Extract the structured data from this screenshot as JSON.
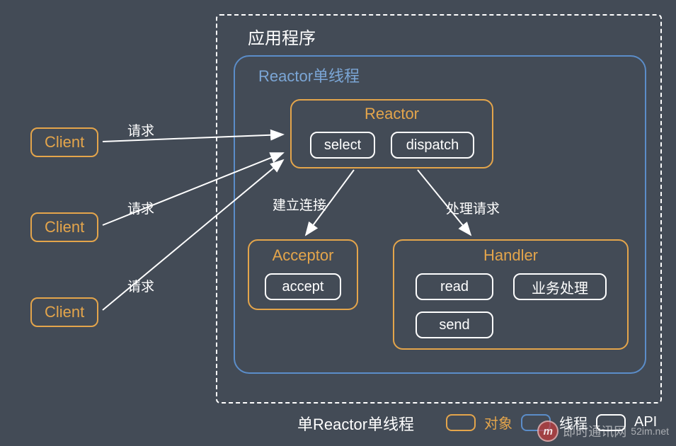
{
  "app": {
    "title": "应用程序"
  },
  "thread": {
    "title": "Reactor单线程"
  },
  "reactor": {
    "title": "Reactor",
    "select": "select",
    "dispatch": "dispatch"
  },
  "acceptor": {
    "title": "Acceptor",
    "accept": "accept"
  },
  "handler": {
    "title": "Handler",
    "read": "read",
    "biz": "业务处理",
    "send": "send"
  },
  "clients": [
    {
      "label": "Client"
    },
    {
      "label": "Client"
    },
    {
      "label": "Client"
    }
  ],
  "edges": {
    "request": "请求",
    "establish": "建立连接",
    "process": "处理请求"
  },
  "caption": "单Reactor单线程",
  "legend": {
    "object": "对象",
    "thread": "线程",
    "api": "API"
  },
  "watermark": {
    "site": "即时通讯网",
    "domain": "52im.net",
    "logo": "m"
  }
}
